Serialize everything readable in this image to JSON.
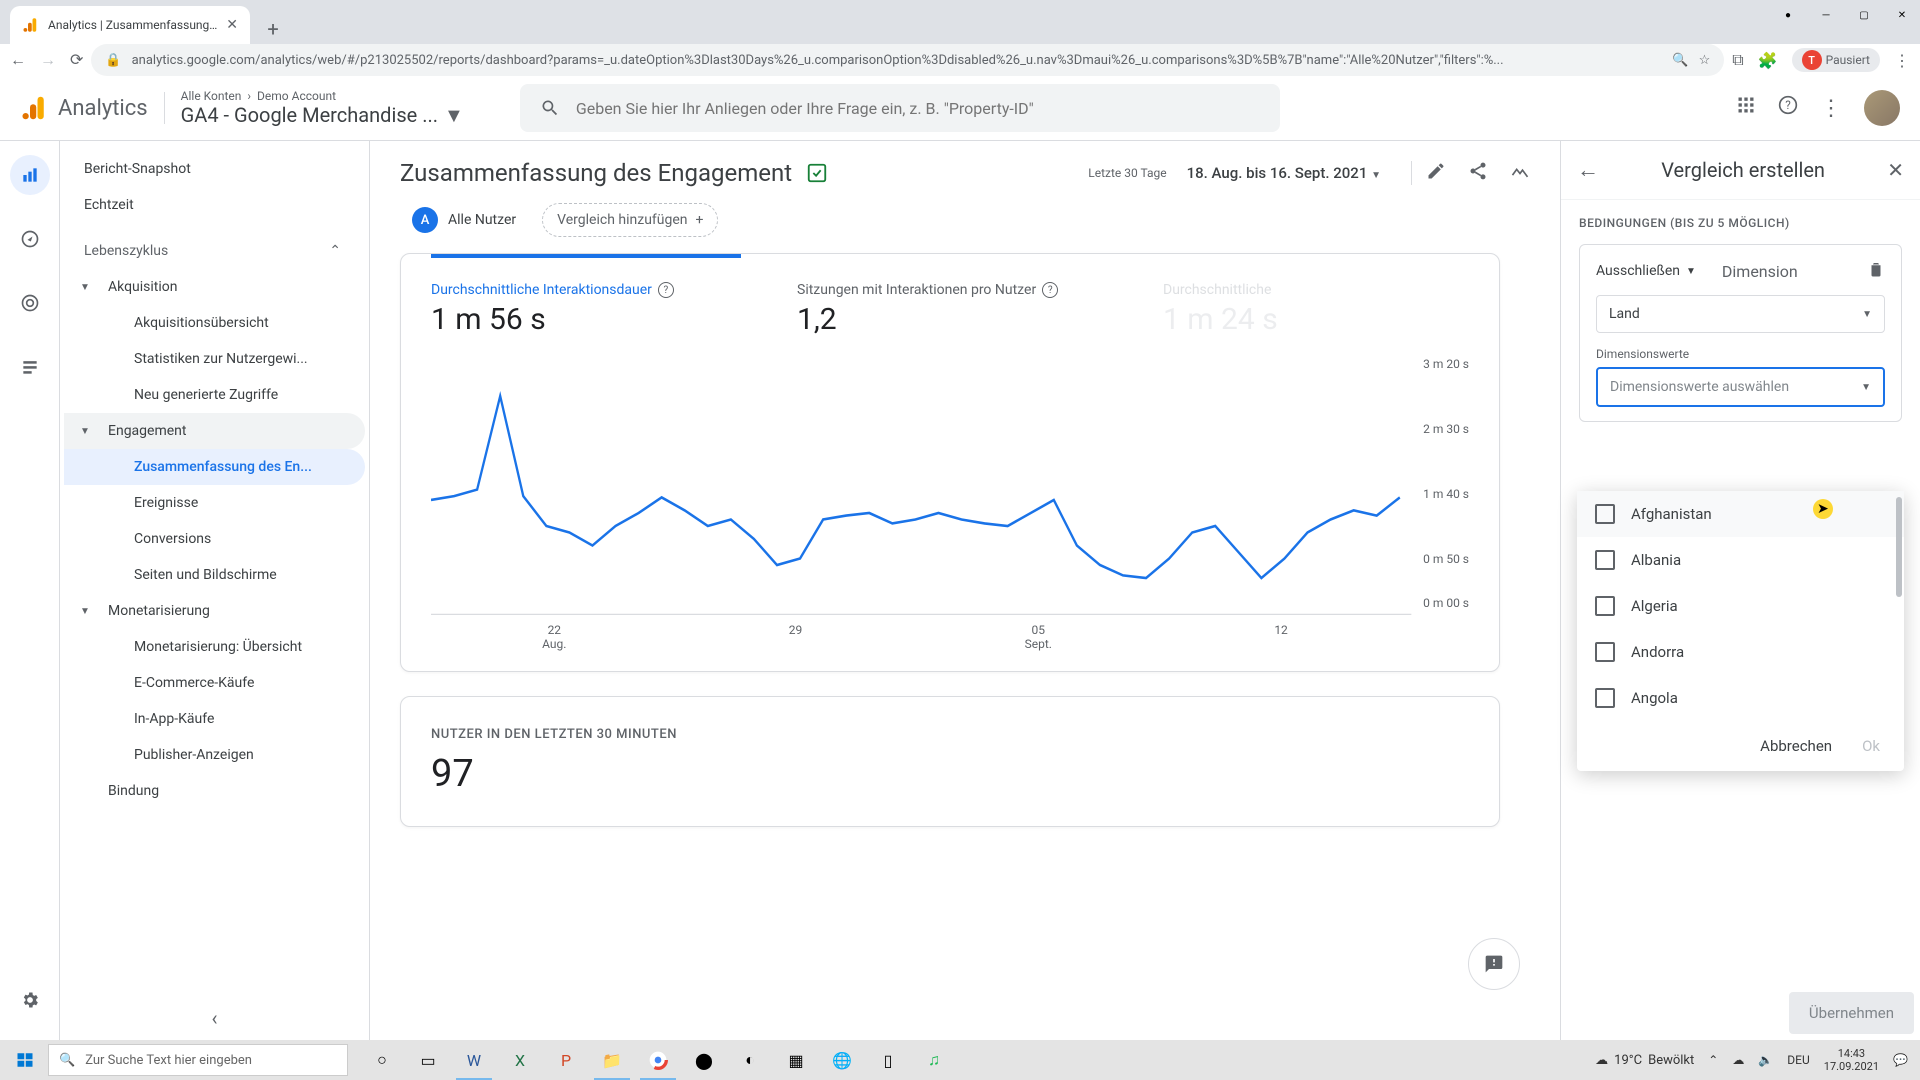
{
  "browser": {
    "tab_title": "Analytics | Zusammenfassung de",
    "url": "analytics.google.com/analytics/web/#/p213025502/reports/dashboard?params=_u.dateOption%3Dlast30Days%26_u.comparisonOption%3Ddisabled%26_u.nav%3Dmaui%26_u.comparisons%3D%5B%7B\"name\":\"Alle%20Nutzer\",\"filters\":%...",
    "ext_status": "Pausiert",
    "ext_initial": "T"
  },
  "ga_header": {
    "brand": "Analytics",
    "breadcrumb_all": "Alle Konten",
    "breadcrumb_account": "Demo Account",
    "property": "GA4 - Google Merchandise ...",
    "search_placeholder": "Geben Sie hier Ihr Anliegen oder Ihre Frage ein, z. B. \"Property-ID\""
  },
  "sidebar": {
    "snapshot": "Bericht-Snapshot",
    "realtime": "Echtzeit",
    "lifecycle": "Lebenszyklus",
    "acquisition": "Akquisition",
    "acq_items": [
      "Akquisitionsübersicht",
      "Statistiken zur Nutzergewi...",
      "Neu generierte Zugriffe"
    ],
    "engagement": "Engagement",
    "eng_items": [
      "Zusammenfassung des En...",
      "Ereignisse",
      "Conversions",
      "Seiten und Bildschirme"
    ],
    "monetization": "Monetarisierung",
    "mon_items": [
      "Monetarisierung: Übersicht",
      "E-Commerce-Käufe",
      "In-App-Käufe",
      "Publisher-Anzeigen"
    ],
    "retention": "Bindung"
  },
  "page": {
    "title": "Zusammenfassung des Engagement",
    "date_label": "Letzte 30 Tage",
    "date_range": "18. Aug. bis 16. Sept. 2021"
  },
  "segments": {
    "all_users_letter": "A",
    "all_users": "Alle Nutzer",
    "add_compare": "Vergleich hinzufügen"
  },
  "metrics": [
    {
      "name": "Durchschnittliche Interaktionsdauer",
      "value": "1 m 56 s"
    },
    {
      "name": "Sitzungen mit Interaktionen pro Nutzer",
      "value": "1,2"
    },
    {
      "name": "Durchschnittliche",
      "value": "1 m 24 s"
    }
  ],
  "chart_data": {
    "type": "line",
    "ylabels": [
      "3 m 20 s",
      "2 m 30 s",
      "1 m 40 s",
      "0 m 50 s",
      "0 m 00 s"
    ],
    "xlabels": [
      "22\nAug.",
      "29",
      "05\nSept.",
      "12"
    ],
    "series": [
      {
        "name": "Durchschnittliche Interaktionsdauer",
        "points": [
          [
            0,
            110
          ],
          [
            20,
            107
          ],
          [
            40,
            102
          ],
          [
            60,
            30
          ],
          [
            80,
            107
          ],
          [
            100,
            130
          ],
          [
            120,
            135
          ],
          [
            140,
            145
          ],
          [
            160,
            130
          ],
          [
            180,
            120
          ],
          [
            200,
            108
          ],
          [
            220,
            118
          ],
          [
            240,
            130
          ],
          [
            260,
            125
          ],
          [
            280,
            140
          ],
          [
            300,
            160
          ],
          [
            320,
            155
          ],
          [
            340,
            125
          ],
          [
            360,
            122
          ],
          [
            380,
            120
          ],
          [
            400,
            128
          ],
          [
            420,
            125
          ],
          [
            440,
            120
          ],
          [
            460,
            125
          ],
          [
            480,
            128
          ],
          [
            500,
            130
          ],
          [
            520,
            120
          ],
          [
            540,
            110
          ],
          [
            560,
            145
          ],
          [
            580,
            160
          ],
          [
            600,
            168
          ],
          [
            620,
            170
          ],
          [
            640,
            155
          ],
          [
            660,
            135
          ],
          [
            680,
            130
          ],
          [
            700,
            150
          ],
          [
            720,
            170
          ],
          [
            740,
            155
          ],
          [
            760,
            135
          ],
          [
            780,
            125
          ],
          [
            800,
            118
          ],
          [
            820,
            122
          ],
          [
            840,
            108
          ]
        ]
      }
    ]
  },
  "users_card": {
    "label": "NUTZER IN DEN LETZTEN 30 MINUTEN",
    "value": "97"
  },
  "panel": {
    "title": "Vergleich erstellen",
    "conditions_label": "BEDINGUNGEN (BIS ZU 5 MÖGLICH)",
    "exclude": "Ausschließen",
    "dimension_label": "Dimension",
    "dimension_value": "Land",
    "values_label": "Dimensionswerte",
    "values_placeholder": "Dimensionswerte auswählen",
    "dropdown_items": [
      "Afghanistan",
      "Albania",
      "Algeria",
      "Andorra",
      "Angola"
    ],
    "cancel": "Abbrechen",
    "ok": "Ok",
    "apply": "Übernehmen"
  },
  "taskbar": {
    "search_placeholder": "Zur Suche Text hier eingeben",
    "weather_temp": "19°C",
    "weather_cond": "Bewölkt",
    "lang": "DEU",
    "time": "14:43",
    "date": "17.09.2021"
  }
}
